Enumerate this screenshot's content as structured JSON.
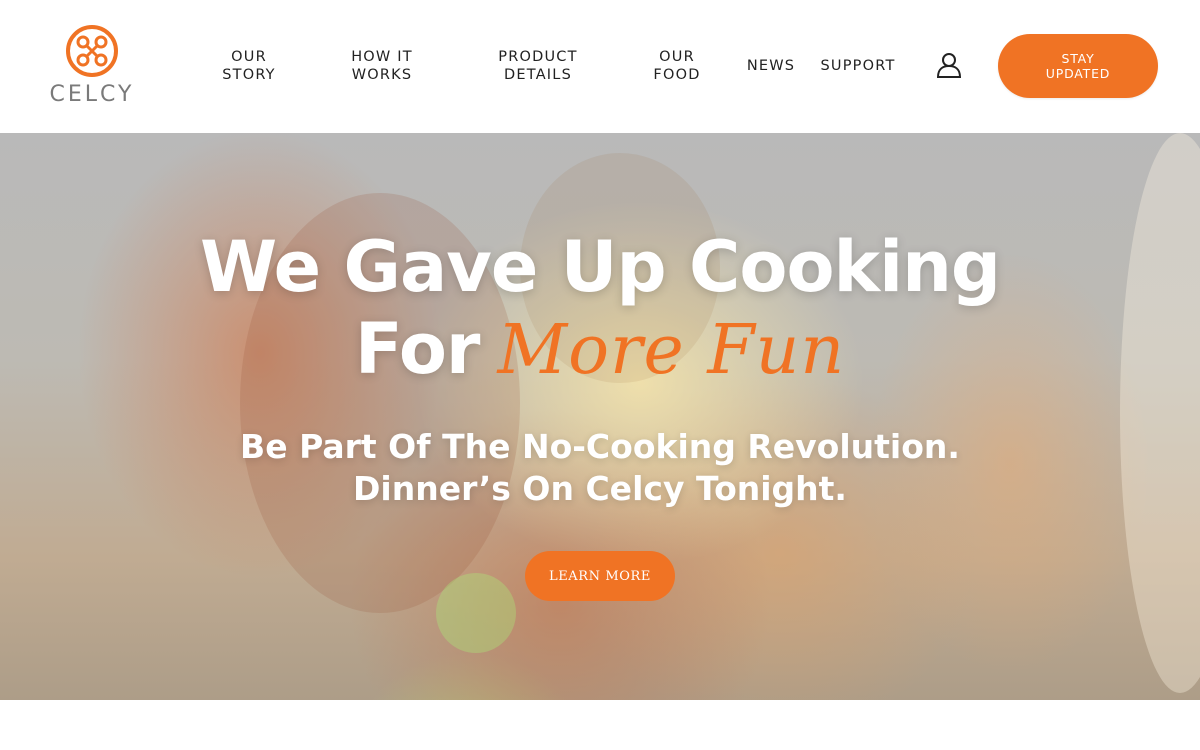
{
  "brand": {
    "name": "CELCY",
    "accent_color": "#f07324"
  },
  "nav": {
    "items": [
      {
        "line1": "OUR",
        "line2": "STORY"
      },
      {
        "line1": "HOW IT",
        "line2": "WORKS"
      },
      {
        "line1": "PRODUCT",
        "line2": "DETAILS"
      },
      {
        "line1": "OUR",
        "line2": "FOOD"
      },
      {
        "line1": "NEWS",
        "line2": ""
      },
      {
        "line1": "SUPPORT",
        "line2": ""
      }
    ],
    "user_icon": "user-icon",
    "cta": {
      "line1": "STAY",
      "line2": "UPDATED"
    }
  },
  "hero": {
    "headline_line1": "We Gave Up Cooking",
    "headline_line2_plain": "For",
    "headline_line2_script": "More Fun",
    "subline1": "Be Part Of The No-Cooking Revolution.",
    "subline2": "Dinner’s On Celcy Tonight.",
    "button_label": "LEARN MORE"
  }
}
